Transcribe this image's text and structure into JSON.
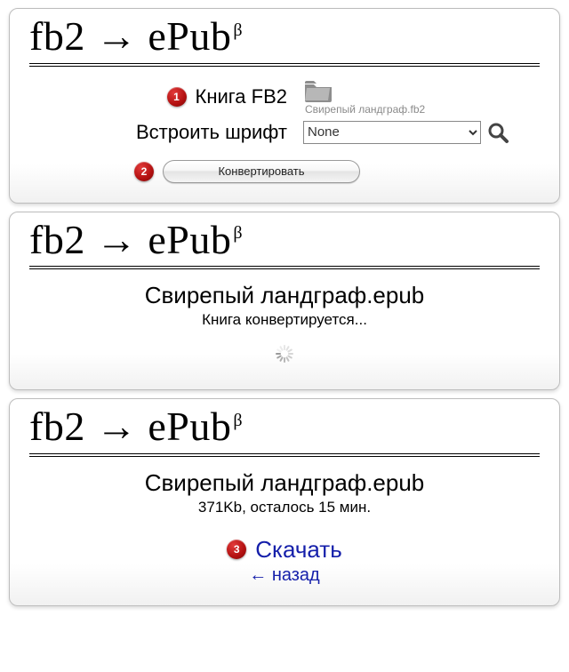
{
  "title": {
    "from": "fb2",
    "arrow": "→",
    "to": "ePub",
    "beta": "β"
  },
  "panel1": {
    "book_label": "Книга FB2",
    "filename": "Свирепый ландграф.fb2",
    "embed_font_label": "Встроить шрифт",
    "font_value": "None",
    "convert_label": "Конвертировать"
  },
  "panel2": {
    "output_name": "Свирепый ландграф.epub",
    "status": "Книга конвертируется..."
  },
  "panel3": {
    "output_name": "Свирепый ландграф.epub",
    "info": "371Kb, осталось 15 мин.",
    "download_label": "Скачать",
    "back_label": "← назад"
  },
  "steps": {
    "one": "1",
    "two": "2",
    "three": "3"
  }
}
